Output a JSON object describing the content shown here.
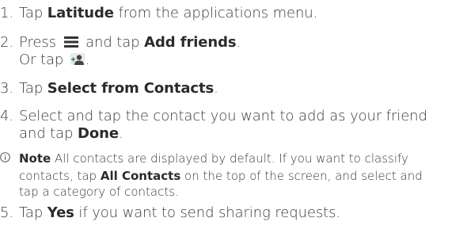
{
  "steps": [
    {
      "num": "1.",
      "pre": "Tap ",
      "bold": "Latitude",
      "post": " from the applications menu."
    },
    {
      "num": "2.",
      "pre": "Press ",
      "icon": "menu-icon",
      "mid": " and tap ",
      "bold": "Add friends",
      "post": ".",
      "line2_pre": "Or tap ",
      "line2_icon": "add-friend-icon",
      "line2_post": "."
    },
    {
      "num": "3.",
      "pre": "Tap ",
      "bold": "Select from Contacts",
      "post": "."
    },
    {
      "num": "4.",
      "line1": "Select and tap the contact you want to add as your friend",
      "line2_pre": "and tap ",
      "bold": "Done",
      "post": "."
    },
    {
      "num": "5.",
      "pre": "Tap ",
      "bold": "Yes",
      "post": " if you want to send sharing requests."
    }
  ],
  "note": {
    "icon": "info-circle-icon",
    "label": "Note",
    "line1_text": " All contacts are displayed by default. If you want to classify",
    "line2_pre": "contacts, tap ",
    "line2_bold": "All Contacts",
    "line2_post": " on the top of the screen, and select and",
    "line3": "tap a category of contacts."
  }
}
